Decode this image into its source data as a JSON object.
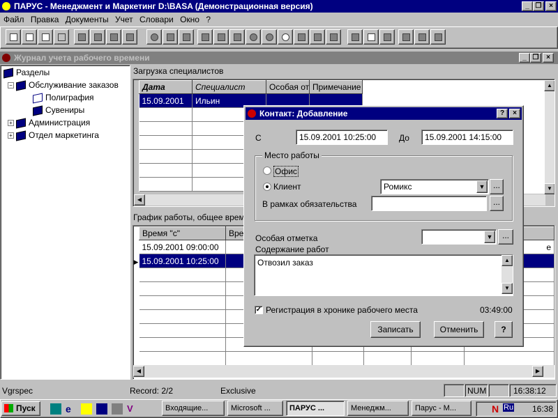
{
  "app": {
    "title": "ПАРУС - Менеджмент и Маркетинг  D:\\BASA (Демонстрационная версия)"
  },
  "menu": [
    "Файл",
    "Правка",
    "Документы",
    "Учет",
    "Словари",
    "Окно",
    "?"
  ],
  "child_window": {
    "title": "Журнал учета рабочего времени"
  },
  "tree": {
    "root": "Разделы",
    "items": [
      {
        "label": "Обслуживание заказов",
        "level": 1,
        "expander": "−"
      },
      {
        "label": "Полиграфия",
        "level": 2,
        "expander": ""
      },
      {
        "label": "Сувениры",
        "level": 2,
        "expander": ""
      },
      {
        "label": "Администрация",
        "level": 1,
        "expander": "+"
      },
      {
        "label": "Отдел маркетинга",
        "level": 1,
        "expander": "+"
      }
    ]
  },
  "upper_panel": {
    "caption": "Загрузка специалистов",
    "columns": [
      "Дата",
      "Специалист",
      "Особая от",
      "Примечание"
    ],
    "rows": [
      [
        "15.09.2001",
        "Ильин",
        "",
        ""
      ]
    ]
  },
  "lower_panel": {
    "caption": "График работы, общее врем",
    "columns": [
      "Время \"с\"",
      "Врем"
    ],
    "rows": [
      [
        "15.09.2001 09:00:00",
        ""
      ],
      [
        "15.09.2001 10:25:00",
        ""
      ]
    ],
    "right_glyph": "е"
  },
  "dialog": {
    "title": "Контакт: Добавление",
    "from_label": "С",
    "from_value": "15.09.2001 10:25:00",
    "to_label": "До",
    "to_value": "15.09.2001 14:15:00",
    "workplace_group": "Место работы",
    "radio_office": "Офис",
    "radio_client": "Клиент",
    "client_value": "Ромикс",
    "commitment_label": "В рамках обязательства",
    "commitment_value": "",
    "special_label": "Особая отметка",
    "special_value": "",
    "content_label": "Содержание работ",
    "content_value": "Отвозил заказ",
    "register_label": "Регистрация в хронике рабочего места",
    "register_time": "03:49:00",
    "save_button": "Записать",
    "cancel_button": "Отменить",
    "help_button": "?"
  },
  "status": {
    "user": "Vgrspec",
    "record": "Record: 2/2",
    "mode": "Exclusive",
    "num": "NUM",
    "time": "16:38:12"
  },
  "taskbar": {
    "start": "Пуск",
    "tasks": [
      "Входящие...",
      "Microsoft ...",
      "ПАРУС ...",
      "Менеджм...",
      "Парус - М..."
    ],
    "tray_lang": "Ru",
    "clock": "16:38"
  }
}
